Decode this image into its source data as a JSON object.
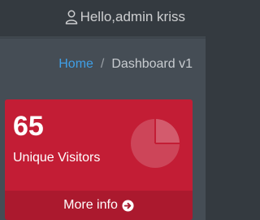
{
  "header": {
    "user_icon": "user-icon",
    "greeting": "Hello,admin kriss"
  },
  "breadcrumb": {
    "home": "Home",
    "separator": "/",
    "current": "Dashboard v1"
  },
  "card": {
    "value": "65",
    "label": "Unique Visitors",
    "icon": "pie-chart-icon",
    "footer_label": "More info",
    "footer_icon": "arrow-circle-right-icon",
    "color": "#c31d35"
  }
}
